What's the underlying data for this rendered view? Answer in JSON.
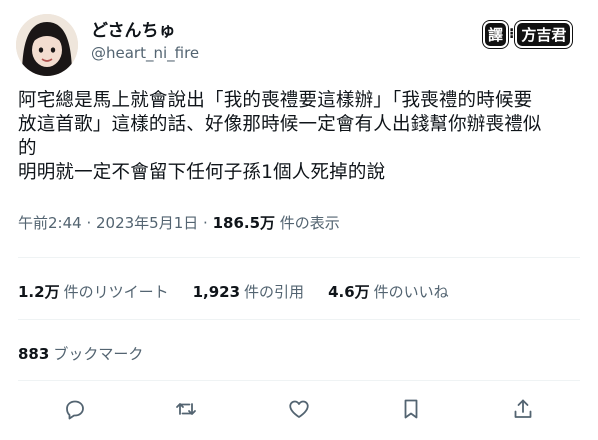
{
  "author": {
    "display_name": "どさんちゅ",
    "handle": "@heart_ni_fire"
  },
  "translator_stamp": {
    "label": "譯",
    "separator": "⁝",
    "name": "方吉君"
  },
  "tweet": {
    "lines": [
      "阿宅總是馬上就會說出「我的喪禮要這樣辦」「我喪禮的時候要",
      "放這首歌」這樣的話、好像那時候一定會有人出錢幫你辦喪禮似",
      "的",
      "明明就一定不會留下任何子孫1個人死掉的說"
    ]
  },
  "meta": {
    "time": "午前2:44",
    "sep1": " · ",
    "date": "2023年5月1日",
    "sep2": " · ",
    "views_count": "186.5万",
    "views_label": " 件の表示"
  },
  "stats": {
    "retweets_count": "1.2万",
    "retweets_label": "件のリツイート",
    "quotes_count": "1,923",
    "quotes_label": "件の引用",
    "likes_count": "4.6万",
    "likes_label": "件のいいね"
  },
  "bookmarks": {
    "count": "883",
    "label": "ブックマーク"
  },
  "actions": {
    "icons": [
      "reply-icon",
      "retweet-icon",
      "like-icon",
      "bookmark-icon",
      "share-icon"
    ]
  },
  "colors": {
    "text": "#0f1419",
    "secondary": "#536471",
    "divider": "#eff3f4"
  }
}
